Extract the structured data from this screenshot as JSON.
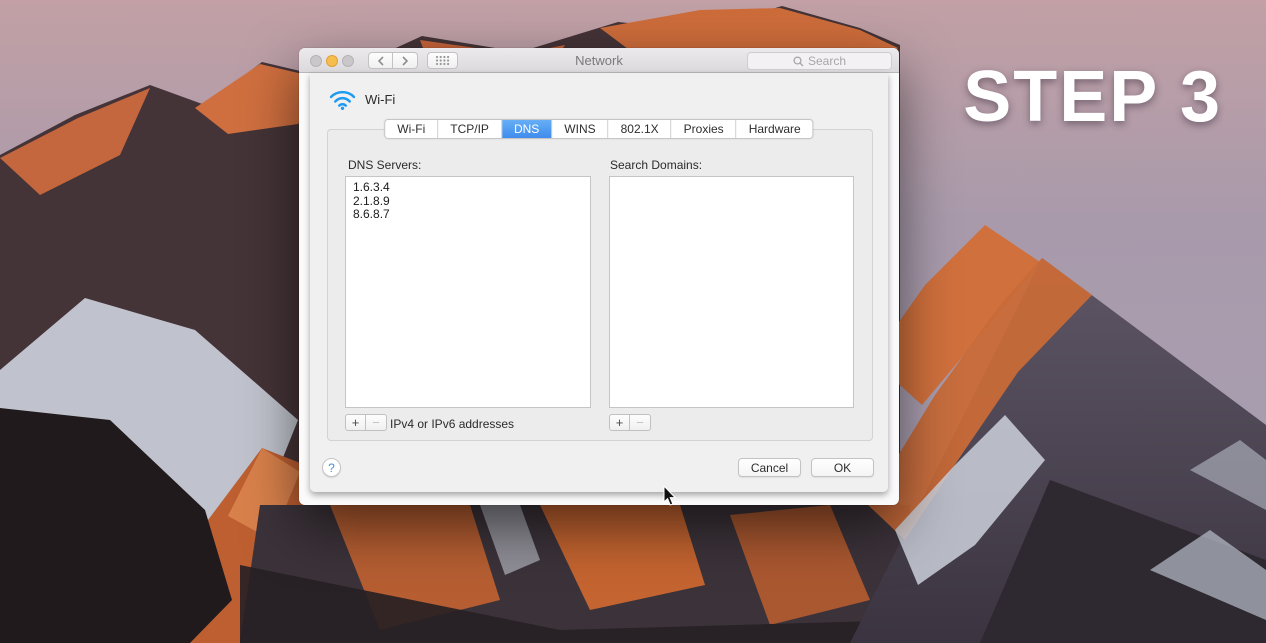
{
  "overlay": {
    "step_label": "STEP 3"
  },
  "window": {
    "title": "Network",
    "search_placeholder": "Search",
    "connection_name": "Wi-Fi"
  },
  "tabs": {
    "selected": "DNS",
    "items": [
      {
        "label": "Wi-Fi"
      },
      {
        "label": "TCP/IP"
      },
      {
        "label": "DNS"
      },
      {
        "label": "WINS"
      },
      {
        "label": "802.1X"
      },
      {
        "label": "Proxies"
      },
      {
        "label": "Hardware"
      }
    ]
  },
  "dns_servers": {
    "label": "DNS Servers:",
    "items": [
      "1.6.3.4",
      "2.1.8.9",
      "8.6.8.7"
    ],
    "add_label": "+",
    "remove_label": "−",
    "hint": "IPv4 or IPv6 addresses"
  },
  "search_domains": {
    "label": "Search Domains:",
    "items": [],
    "add_label": "+",
    "remove_label": "−"
  },
  "footer": {
    "help_label": "?",
    "cancel_label": "Cancel",
    "ok_label": "OK"
  },
  "icons": {
    "wifi": "wifi-icon",
    "search": "search-icon",
    "grid": "launchpad-grid-icon",
    "back": "chevron-left-icon",
    "forward": "chevron-right-icon"
  },
  "colors": {
    "accent_blue": "#4A9CF0",
    "wifi_icon_blue": "#1D9BF1",
    "selected_tab_text": "#FFFFFF",
    "minimize_yellow": "#F6BE4F"
  }
}
